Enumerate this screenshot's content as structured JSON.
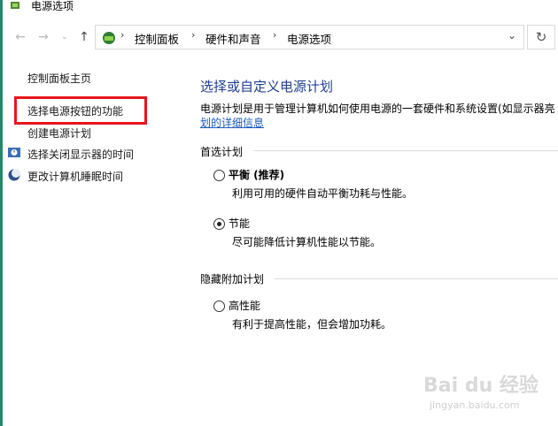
{
  "window": {
    "title": "电源选项"
  },
  "nav": {
    "back_icon": "arrow-left-icon",
    "forward_icon": "arrow-right-icon",
    "recent_icon": "chevron-down-icon",
    "up_icon": "arrow-up-icon",
    "breadcrumbs": [
      "控制面板",
      "硬件和声音",
      "电源选项"
    ],
    "refresh_icon": "refresh-icon"
  },
  "sidebar": {
    "items": [
      {
        "label": "控制面板主页"
      },
      {
        "label": "选择电源按钮的功能"
      },
      {
        "label": "创建电源计划"
      },
      {
        "label": "选择关闭显示器的时间"
      },
      {
        "label": "更改计算机睡眠时间"
      }
    ],
    "highlight_color": "#e8141b"
  },
  "main": {
    "title": "选择或自定义电源计划",
    "description": "电源计划是用于管理计算机如何使用电源的一套硬件和系统设置(如显示器亮",
    "description_link": "划的详细信息",
    "preferred_group": "首选计划",
    "hidden_group": "隐藏附加计划",
    "plans": [
      {
        "name": "平衡 (推荐)",
        "desc": "利用可用的硬件自动平衡功耗与性能。",
        "selected": false
      },
      {
        "name": "节能",
        "desc": "尽可能降低计算机性能以节能。",
        "selected": true
      },
      {
        "name": "高性能",
        "desc": "有利于提高性能，但会增加功耗。",
        "selected": false
      }
    ]
  },
  "watermark": {
    "text": "Bai du 经验",
    "sub": "jingyan.baidu.com"
  },
  "colors": {
    "title_blue": "#1f3f8f",
    "link_blue": "#1a5bbd",
    "accent_strip": "#1e8a6b"
  }
}
